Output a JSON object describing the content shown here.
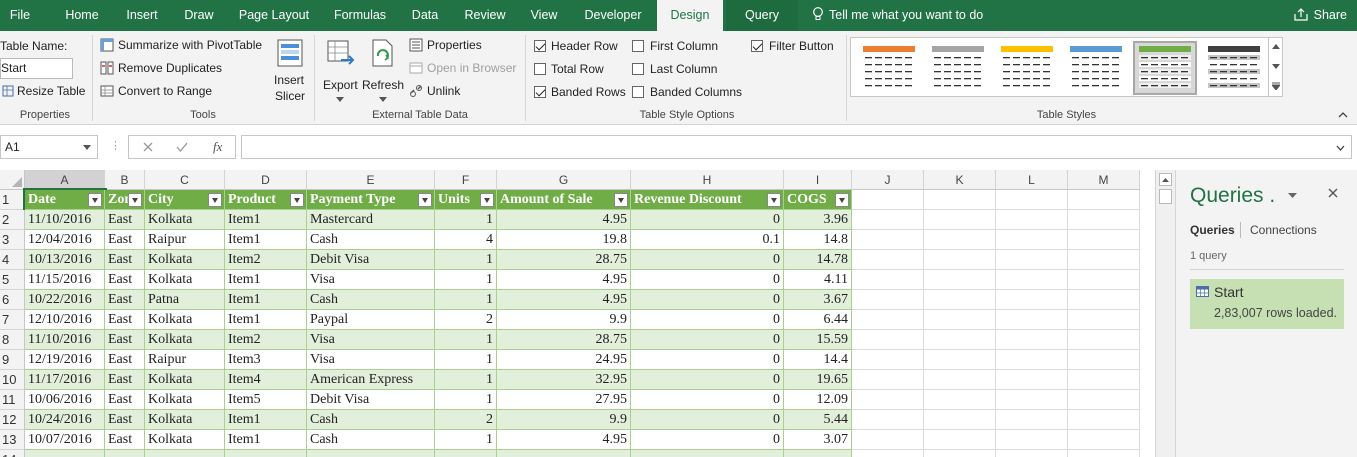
{
  "ribbon_tabs": [
    "File",
    "Home",
    "Insert",
    "Draw",
    "Page Layout",
    "Formulas",
    "Data",
    "Review",
    "View",
    "Developer",
    "Design",
    "Query"
  ],
  "tell_me": "Tell me what you want to do",
  "share": "Share",
  "properties": {
    "table_name_label": "Table Name:",
    "table_name_value": "Start",
    "resize_table": "Resize Table",
    "group": "Properties"
  },
  "tools": {
    "summarize": "Summarize with PivotTable",
    "remove_duplicates": "Remove Duplicates",
    "convert_to_range": "Convert to Range",
    "insert_slicer_1": "Insert",
    "insert_slicer_2": "Slicer",
    "group": "Tools"
  },
  "external": {
    "export": "Export",
    "refresh": "Refresh",
    "properties": "Properties",
    "open_in_browser": "Open in Browser",
    "unlink": "Unlink",
    "group": "External Table Data"
  },
  "style_options": {
    "header_row": "Header Row",
    "total_row": "Total Row",
    "banded_rows": "Banded Rows",
    "first_column": "First Column",
    "last_column": "Last Column",
    "banded_columns": "Banded Columns",
    "filter_button": "Filter Button",
    "group": "Table Style Options"
  },
  "table_styles": {
    "group": "Table Styles",
    "swatch_colors": [
      "#ed7d31",
      "#a5a5a5",
      "#ffc000",
      "#5b9bd5",
      "#70ad47",
      "#404040"
    ],
    "selected_index": 4
  },
  "formula_bar": {
    "name_box": "A1",
    "fx": "fx",
    "formula": ""
  },
  "columns": [
    "A",
    "B",
    "C",
    "D",
    "E",
    "F",
    "G",
    "H",
    "I",
    "J",
    "K",
    "L",
    "M"
  ],
  "table": {
    "headers": [
      "Date",
      "Zone",
      "City",
      "Product",
      "Payment Type",
      "Units",
      "Amount of Sale",
      "Revenue Discount",
      "COGS"
    ],
    "rows": [
      [
        "11/10/2016",
        "East",
        "Kolkata",
        "Item1",
        "Mastercard",
        "1",
        "4.95",
        "0",
        "3.96"
      ],
      [
        "12/04/2016",
        "East",
        "Raipur",
        "Item1",
        "Cash",
        "4",
        "19.8",
        "0.1",
        "14.8"
      ],
      [
        "10/13/2016",
        "East",
        "Kolkata",
        "Item2",
        "Debit Visa",
        "1",
        "28.75",
        "0",
        "14.78"
      ],
      [
        "11/15/2016",
        "East",
        "Kolkata",
        "Item1",
        "Visa",
        "1",
        "4.95",
        "0",
        "4.11"
      ],
      [
        "10/22/2016",
        "East",
        "Patna",
        "Item1",
        "Cash",
        "1",
        "4.95",
        "0",
        "3.67"
      ],
      [
        "12/10/2016",
        "East",
        "Kolkata",
        "Item1",
        "Paypal",
        "2",
        "9.9",
        "0",
        "6.44"
      ],
      [
        "11/10/2016",
        "East",
        "Kolkata",
        "Item2",
        "Visa",
        "1",
        "28.75",
        "0",
        "15.59"
      ],
      [
        "12/19/2016",
        "East",
        "Raipur",
        "Item3",
        "Visa",
        "1",
        "24.95",
        "0",
        "14.4"
      ],
      [
        "11/17/2016",
        "East",
        "Kolkata",
        "Item4",
        "American Express",
        "1",
        "32.95",
        "0",
        "19.65"
      ],
      [
        "10/06/2016",
        "East",
        "Kolkata",
        "Item5",
        "Debit Visa",
        "1",
        "27.95",
        "0",
        "12.09"
      ],
      [
        "10/24/2016",
        "East",
        "Kolkata",
        "Item1",
        "Cash",
        "2",
        "9.9",
        "0",
        "5.44"
      ],
      [
        "10/07/2016",
        "East",
        "Kolkata",
        "Item1",
        "Cash",
        "1",
        "4.95",
        "0",
        "3.07"
      ]
    ]
  },
  "queries_pane": {
    "title": "Queries .",
    "tab_queries": "Queries",
    "tab_connections": "Connections",
    "count": "1 query",
    "query_name": "Start",
    "query_status": "2,83,007 rows loaded."
  },
  "colors": {
    "excel_green": "#217346",
    "table_header": "#70ad47",
    "band": "#e2efda"
  }
}
